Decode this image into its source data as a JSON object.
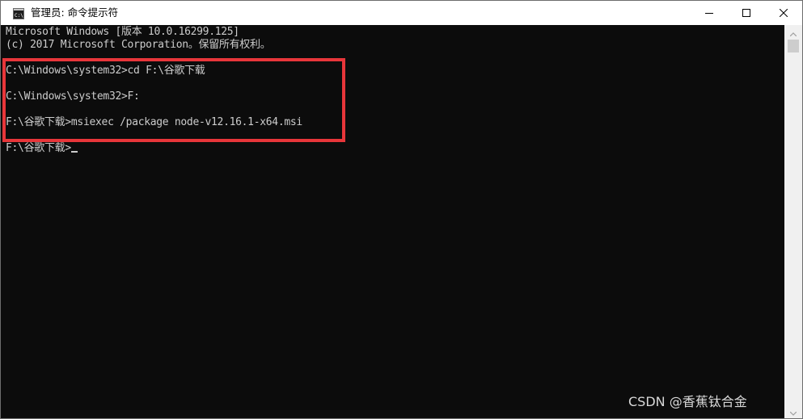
{
  "window": {
    "title": "管理员: 命令提示符",
    "icon": "cmd-icon",
    "controls": {
      "minimize_icon": "minimize-icon",
      "maximize_icon": "maximize-icon",
      "close_icon": "close-icon"
    }
  },
  "console": {
    "lines": [
      "Microsoft Windows [版本 10.0.16299.125]",
      "(c) 2017 Microsoft Corporation。保留所有权利。",
      "C:\\Windows\\system32>cd F:\\谷歌下载",
      "C:\\Windows\\system32>F:",
      "F:\\谷歌下载>msiexec /package node-v12.16.1-x64.msi",
      "F:\\谷歌下载>"
    ],
    "text_color": "#cccccc",
    "background_color": "#0c0c0c"
  },
  "annotation": {
    "highlight_color": "#e8363a"
  },
  "watermark": {
    "text": "CSDN @香蕉钛合金"
  }
}
